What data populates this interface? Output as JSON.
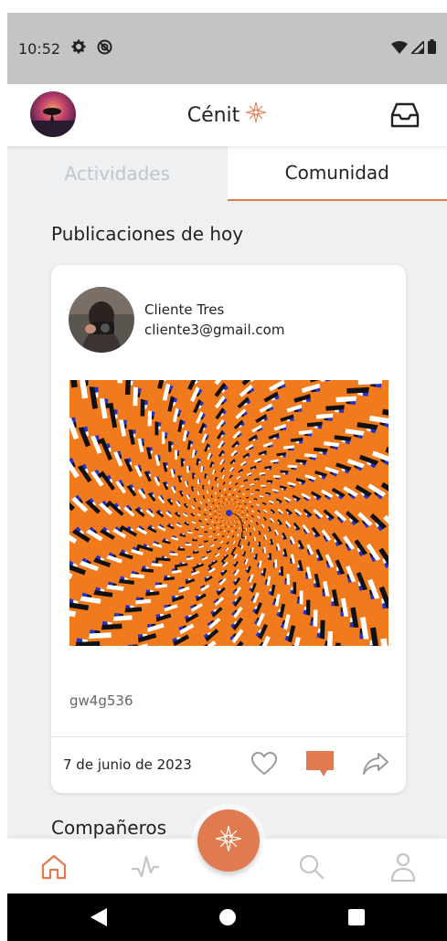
{
  "status_bar": {
    "time": "10:52"
  },
  "header": {
    "title": "Cénit"
  },
  "tabs": [
    {
      "label": "Actividades",
      "active": false
    },
    {
      "label": "Comunidad",
      "active": true
    }
  ],
  "feed": {
    "section_title": "Publicaciones de hoy",
    "post": {
      "author_name": "Cliente Tres",
      "author_email": "cliente3@gmail.com",
      "text": "gw4g536",
      "date": "7 de junio de 2023"
    },
    "companions_title": "Compañeros"
  },
  "bottom_nav": {
    "items": [
      "home-icon",
      "activity-icon",
      "compass-fab-icon",
      "search-icon",
      "profile-icon"
    ],
    "active": "home-icon"
  },
  "colors": {
    "accent": "#e07b4f",
    "inactive_icon": "#c4c4c4",
    "status_bar": "#c4c4c4",
    "background": "#eef0f2"
  }
}
